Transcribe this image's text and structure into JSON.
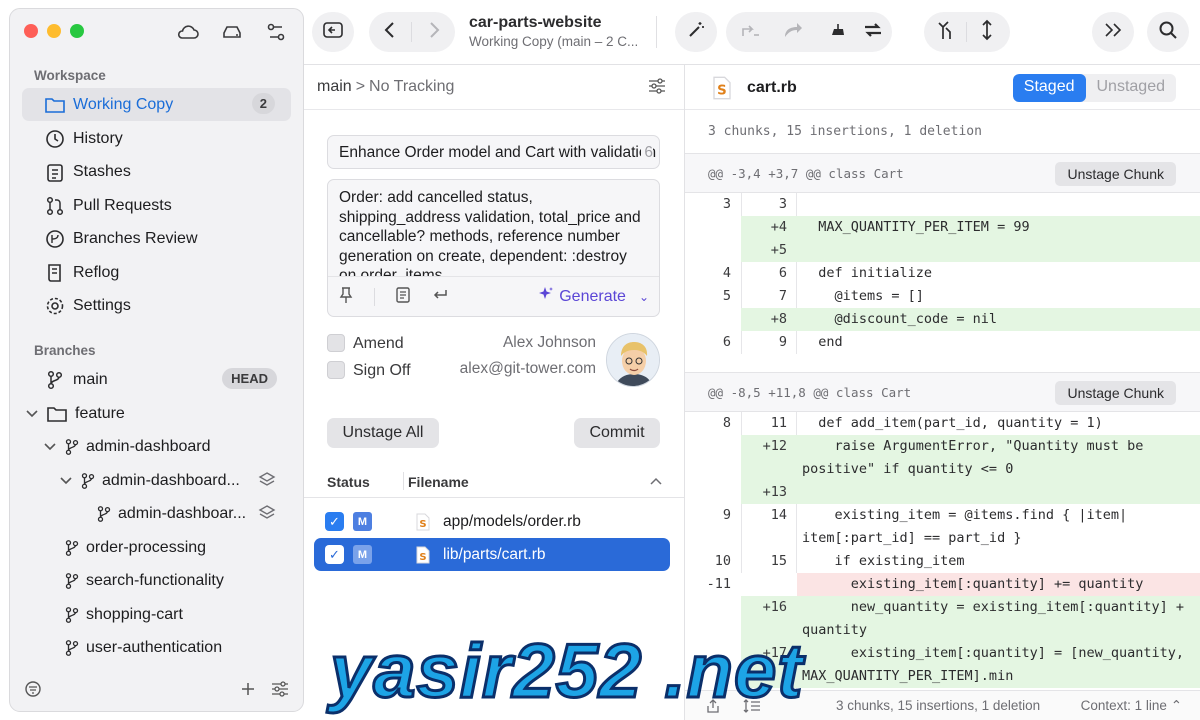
{
  "window": {
    "title": "car-parts-website",
    "subtitle": "Working Copy (main – 2 C..."
  },
  "sidebar": {
    "workspace_label": "Workspace",
    "items": [
      {
        "label": "Working Copy",
        "badge": "2",
        "icon": "folder-icon"
      },
      {
        "label": "History",
        "icon": "clock-icon"
      },
      {
        "label": "Stashes",
        "icon": "clipboard-icon"
      },
      {
        "label": "Pull Requests",
        "icon": "pull-request-icon"
      },
      {
        "label": "Branches Review",
        "icon": "branches-review-icon"
      },
      {
        "label": "Reflog",
        "icon": "book-icon"
      },
      {
        "label": "Settings",
        "icon": "gear-icon"
      }
    ],
    "branches_label": "Branches",
    "branches": [
      {
        "label": "main",
        "badge": "HEAD"
      },
      {
        "label": "feature"
      },
      {
        "label": "admin-dashboard"
      },
      {
        "label": "admin-dashboard..."
      },
      {
        "label": "admin-dashboar..."
      },
      {
        "label": "order-processing"
      },
      {
        "label": "search-functionality"
      },
      {
        "label": "shopping-cart"
      },
      {
        "label": "user-authentication"
      }
    ]
  },
  "commit": {
    "branch": "main",
    "tracking": "No Tracking",
    "summary": "Enhance Order model and Cart with validation",
    "summary_count": "6",
    "description": "Order: add cancelled status, shipping_address validation, total_price and cancellable? methods, reference number generation on create, dependent: :destroy on order_items",
    "generate_label": "Generate",
    "amend_label": "Amend",
    "signoff_label": "Sign Off",
    "author_name": "Alex Johnson",
    "author_email": "alex@git-tower.com",
    "unstage_all_label": "Unstage All",
    "commit_label": "Commit"
  },
  "file_list": {
    "col_status": "Status",
    "col_filename": "Filename",
    "files": [
      {
        "status": "M",
        "path": "app/models/order.rb",
        "selected": false
      },
      {
        "status": "M",
        "path": "lib/parts/cart.rb",
        "selected": true
      }
    ]
  },
  "diff": {
    "filename": "cart.rb",
    "tab_staged": "Staged",
    "tab_unstaged": "Unstaged",
    "stats": "3 chunks, 15 insertions, 1 deletion",
    "hunk1_header": "@@ -3,4 +3,7 @@ class Cart",
    "hunk2_header": "@@ -8,5 +11,8 @@ class Cart",
    "unstage_chunk_label": "Unstage Chunk",
    "lines1": [
      {
        "o": "3",
        "n": "3",
        "t": "",
        "type": "ctx"
      },
      {
        "o": "",
        "n": "+4",
        "t": "  MAX_QUANTITY_PER_ITEM = 99",
        "type": "add"
      },
      {
        "o": "",
        "n": "+5",
        "t": "",
        "type": "add"
      },
      {
        "o": "4",
        "n": "6",
        "t": "  def initialize",
        "type": "ctx"
      },
      {
        "o": "5",
        "n": "7",
        "t": "    @items = []",
        "type": "ctx"
      },
      {
        "o": "",
        "n": "+8",
        "t": "    @discount_code = nil",
        "type": "add"
      },
      {
        "o": "6",
        "n": "9",
        "t": "  end",
        "type": "ctx"
      }
    ],
    "lines2": [
      {
        "o": "8",
        "n": "11",
        "t": "  def add_item(part_id, quantity = 1)",
        "type": "ctx"
      },
      {
        "o": "",
        "n": "+12",
        "t": "    raise ArgumentError, \"Quantity must be",
        "type": "add"
      },
      {
        "o": "",
        "n": "",
        "t": "positive\" if quantity <= 0",
        "type": "add"
      },
      {
        "o": "",
        "n": "+13",
        "t": "",
        "type": "add"
      },
      {
        "o": "9",
        "n": "14",
        "t": "    existing_item = @items.find { |item|",
        "type": "ctx"
      },
      {
        "o": "",
        "n": "",
        "t": "item[:part_id] == part_id }",
        "type": "ctx"
      },
      {
        "o": "10",
        "n": "15",
        "t": "    if existing_item",
        "type": "ctx"
      },
      {
        "o": "-11",
        "n": "",
        "t": "      existing_item[:quantity] += quantity",
        "type": "del"
      },
      {
        "o": "",
        "n": "+16",
        "t": "      new_quantity = existing_item[:quantity] +",
        "type": "add"
      },
      {
        "o": "",
        "n": "",
        "t": "quantity",
        "type": "add"
      },
      {
        "o": "",
        "n": "+17",
        "t": "      existing_item[:quantity] = [new_quantity,",
        "type": "add"
      },
      {
        "o": "",
        "n": "",
        "t": "MAX_QUANTITY_PER_ITEM].min",
        "type": "add"
      }
    ],
    "footer_stats": "3 chunks, 15 insertions, 1 deletion",
    "context_label": "Context: 1 line"
  },
  "watermark": "yasir252 .net"
}
